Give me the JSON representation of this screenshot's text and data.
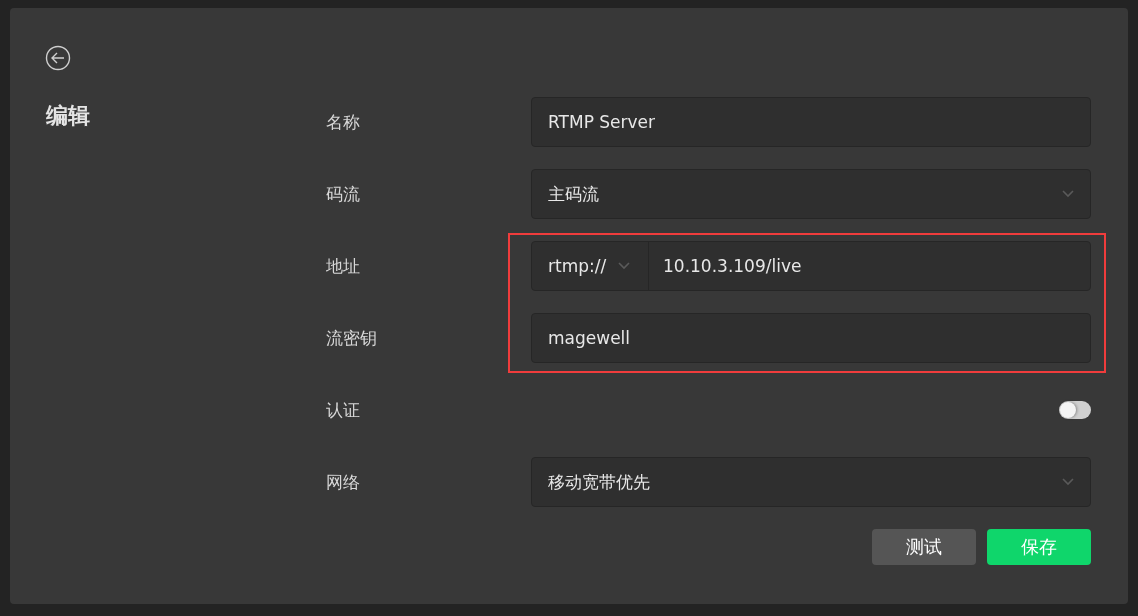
{
  "title": "编辑",
  "fields": [
    {
      "kind": "text",
      "label": "名称",
      "value": "RTMP Server"
    },
    {
      "kind": "select",
      "label": "码流",
      "value": "主码流"
    },
    {
      "kind": "url",
      "label": "地址",
      "scheme": "rtmp://",
      "value": "10.10.3.109/live",
      "highlighted": true
    },
    {
      "kind": "text",
      "label": "流密钥",
      "value": "magewell",
      "highlighted": true
    },
    {
      "kind": "toggle",
      "label": "认证",
      "on": false
    },
    {
      "kind": "select",
      "label": "网络",
      "value": "移动宽带优先"
    }
  ],
  "buttons": [
    {
      "kind": "secondary",
      "label": "测试"
    },
    {
      "kind": "primary",
      "label": "保存"
    }
  ]
}
